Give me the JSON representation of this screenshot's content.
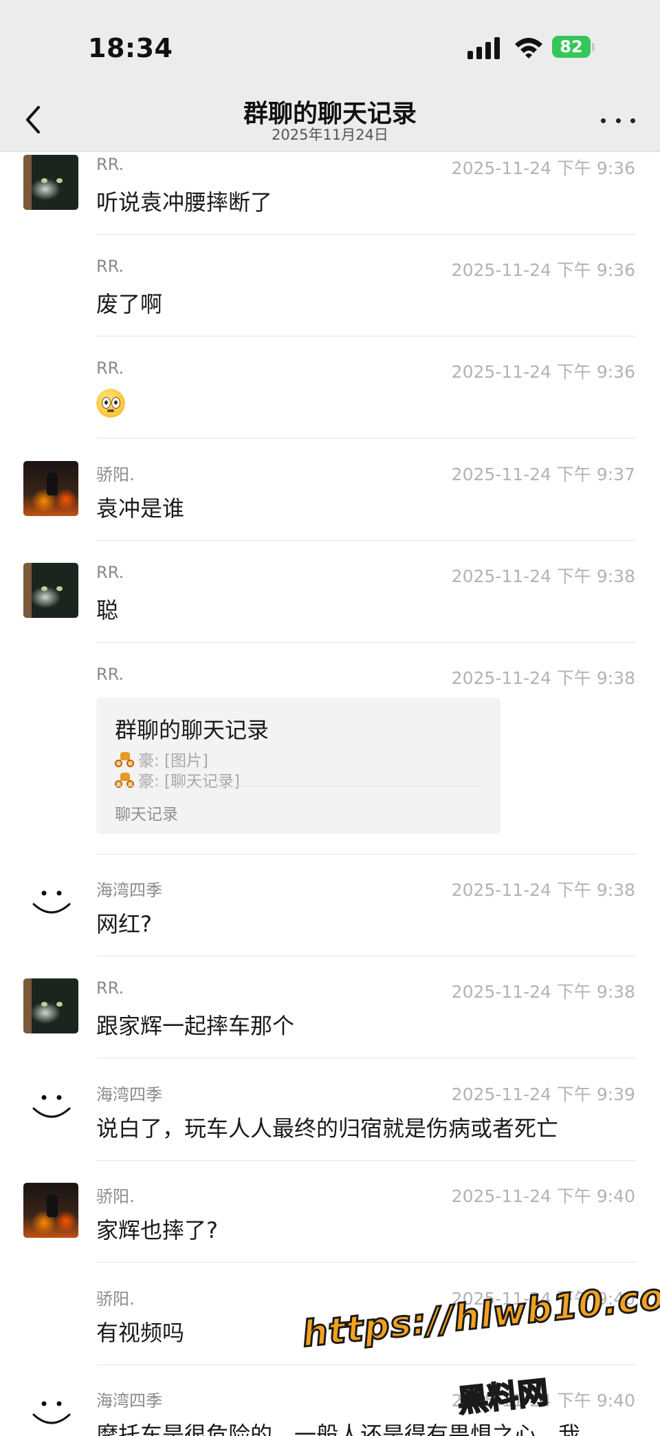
{
  "status_bar": {
    "time": "18:34",
    "battery": "82",
    "icons": [
      "signal-icon",
      "wifi-icon",
      "battery-icon"
    ]
  },
  "header": {
    "title": "群聊的聊天记录",
    "subtitle": "2025年11月24日",
    "icons": [
      "back-chevron-icon",
      "more-icon"
    ]
  },
  "messages": [
    {
      "sender": "RR.",
      "time": "2025-11-24 下午 9:36",
      "text": "听说袁冲腰摔断了",
      "avatar": "cat"
    },
    {
      "sender": "RR.",
      "time": "2025-11-24 下午 9:36",
      "text": "废了啊",
      "avatar": "none"
    },
    {
      "sender": "RR.",
      "time": "2025-11-24 下午 9:36",
      "text": "",
      "emoji": "flushed-face",
      "avatar": "none"
    },
    {
      "sender": "骄阳.",
      "time": "2025-11-24 下午 9:37",
      "text": "袁冲是谁",
      "avatar": "motorcycle"
    },
    {
      "sender": "RR.",
      "time": "2025-11-24 下午 9:38",
      "text": "聪",
      "avatar": "cat"
    },
    {
      "sender": "RR.",
      "time": "2025-11-24 下午 9:38",
      "avatar": "none",
      "card": {
        "title": "群聊的聊天记录",
        "lines": [
          "豪: [图片]",
          "豪: [聊天记录]"
        ],
        "footer": "聊天记录"
      }
    },
    {
      "sender": "海湾四季",
      "time": "2025-11-24 下午 9:38",
      "text": "网红?",
      "avatar": "smile"
    },
    {
      "sender": "RR.",
      "time": "2025-11-24 下午 9:38",
      "text": "跟家辉一起摔车那个",
      "avatar": "cat"
    },
    {
      "sender": "海湾四季",
      "time": "2025-11-24 下午 9:39",
      "text": "说白了，玩车人人最终的归宿就是伤病或者死亡",
      "avatar": "smile"
    },
    {
      "sender": "骄阳.",
      "time": "2025-11-24 下午 9:40",
      "text": "家辉也摔了?",
      "avatar": "motorcycle"
    },
    {
      "sender": "骄阳.",
      "time": "2025-11-24 下午 9:40",
      "text": "有视频吗",
      "avatar": "none"
    },
    {
      "sender": "海湾四季",
      "time": "2025-11-24 下午 9:40",
      "text": "摩托车是很危险的，一般人还是得有畏惧之心，我",
      "avatar": "smile"
    }
  ],
  "watermark": {
    "url": "https://hlwb10.com",
    "brand": "黑料网"
  }
}
